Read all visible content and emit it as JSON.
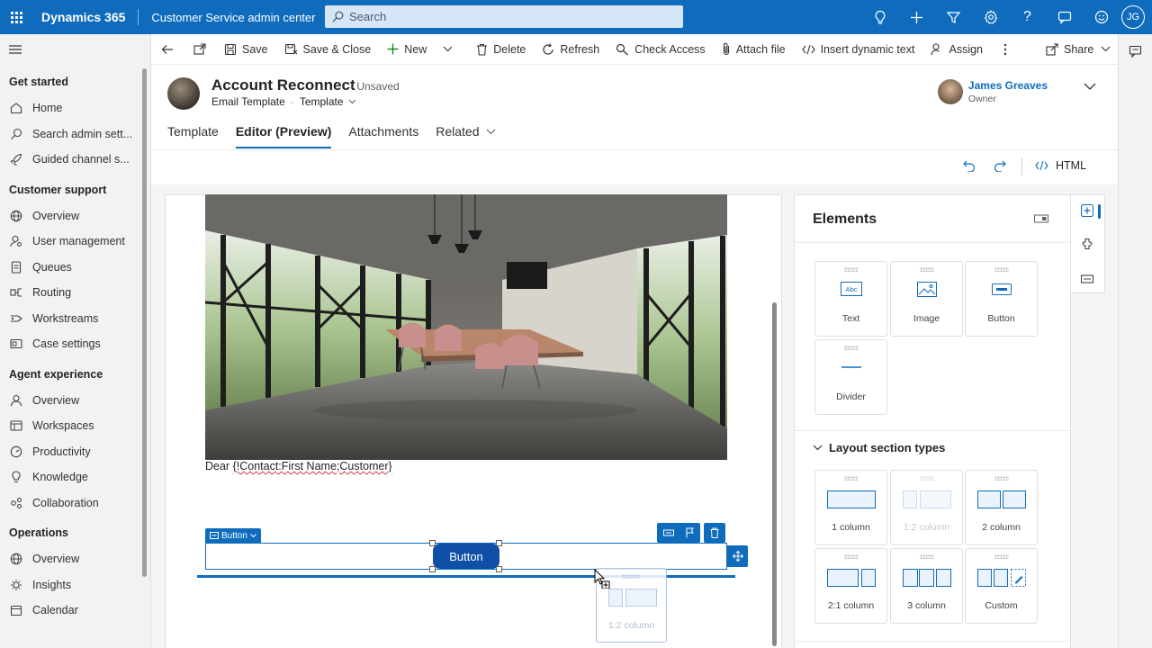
{
  "topbar": {
    "app_name": "Dynamics 365",
    "area_name": "Customer Service admin center",
    "search_placeholder": "Search",
    "user_initials": "JG"
  },
  "nav": {
    "groups": [
      {
        "label": "Get started",
        "items": [
          "Home",
          "Search admin sett...",
          "Guided channel s..."
        ]
      },
      {
        "label": "Customer support",
        "items": [
          "Overview",
          "User management",
          "Queues",
          "Routing",
          "Workstreams",
          "Case settings"
        ]
      },
      {
        "label": "Agent experience",
        "items": [
          "Overview",
          "Workspaces",
          "Productivity",
          "Knowledge",
          "Collaboration"
        ]
      },
      {
        "label": "Operations",
        "items": [
          "Overview",
          "Insights",
          "Calendar"
        ]
      }
    ]
  },
  "commands": {
    "save": "Save",
    "save_close": "Save & Close",
    "new": "New",
    "delete": "Delete",
    "refresh": "Refresh",
    "check_access": "Check Access",
    "attach_file": "Attach file",
    "insert_dynamic": "Insert dynamic text",
    "assign": "Assign",
    "share": "Share"
  },
  "record": {
    "title": "Account Reconnect",
    "status": "- Unsaved",
    "entity": "Email Template",
    "form": "Template",
    "owner_name": "James Greaves",
    "owner_role": "Owner"
  },
  "tabs": [
    "Template",
    "Editor (Preview)",
    "Attachments",
    "Related"
  ],
  "editor": {
    "html_label": "HTML",
    "greeting_prefix": "Dear ",
    "greeting_token": "{!Contact:First Name;Customer}",
    "block_tag": "Button",
    "button_text": "Button",
    "ghost_label": "1:2 column"
  },
  "elements_panel": {
    "title": "Elements",
    "elements": [
      "Text",
      "Image",
      "Button",
      "Divider"
    ],
    "layout_heading": "Layout section types",
    "layouts": [
      "1 column",
      "1:2 column",
      "2 column",
      "2:1 column",
      "3 column",
      "Custom"
    ]
  },
  "colors": {
    "brand": "#0f6cbd",
    "button_fill": "#0f4fa8"
  }
}
